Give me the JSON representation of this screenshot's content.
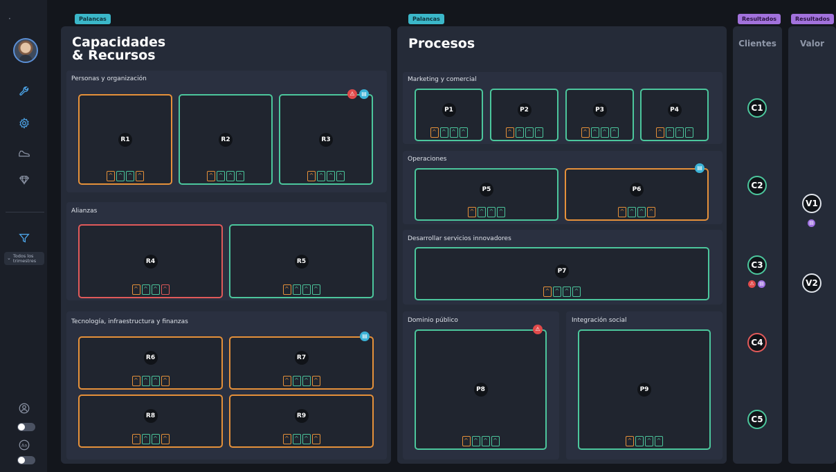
{
  "sidebar": {
    "quarter_filter": "Todos los trimestres",
    "icons": [
      "wrench-icon",
      "settings-icon",
      "shoe-icon",
      "diamond-icon",
      "filter-icon",
      "user-icon",
      "font-icon"
    ]
  },
  "colors": {
    "green": "#4cc79d",
    "orange": "#e6913a",
    "red": "#e25a5a",
    "teal_tag": "#3bb7c9",
    "purple_tag": "#a272dc"
  },
  "left_panel": {
    "tag": "Palancas",
    "title_line1": "Capacidades",
    "title_line2": "& Recursos",
    "sections": {
      "personas": "Personas y organización",
      "alianzas": "Alianzas",
      "tecnologia": "Tecnología, infraestructura y finanzas"
    },
    "cards": {
      "r1": "R1",
      "r2": "R2",
      "r3": "R3",
      "r4": "R4",
      "r5": "R5",
      "r6": "R6",
      "r7": "R7",
      "r8": "R8",
      "r9": "R9"
    }
  },
  "middle_panel": {
    "tag": "Palancas",
    "title": "Procesos",
    "sections": {
      "marketing": "Marketing y comercial",
      "operaciones": "Operaciones",
      "innovadores": "Desarrollar servicios innovadores",
      "dominio": "Dominio público",
      "integracion": "Integración social"
    },
    "cards": {
      "p1": "P1",
      "p2": "P2",
      "p3": "P3",
      "p4": "P4",
      "p5": "P5",
      "p6": "P6",
      "p7": "P7",
      "p8": "P8",
      "p9": "P9"
    }
  },
  "clientes": {
    "tag": "Resultados",
    "title": "Clientes",
    "items": [
      "C1",
      "C2",
      "C3",
      "C4",
      "C5"
    ]
  },
  "valor": {
    "tag": "Resultados",
    "title": "Valor",
    "items": [
      "V1",
      "V2"
    ]
  },
  "glyphs": {
    "arrow": "^",
    "warn": "⚠",
    "msg": "▤"
  }
}
